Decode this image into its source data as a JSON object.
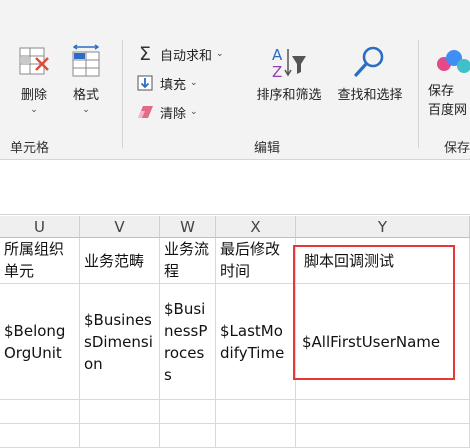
{
  "ribbon": {
    "cells_group": {
      "label": "单元格",
      "delete_label": "删除",
      "format_label": "格式"
    },
    "editing_group": {
      "label": "编辑",
      "autosum_label": "自动求和",
      "fill_label": "填充",
      "clear_label": "清除",
      "sort_filter_label": "排序和筛选",
      "find_select_label": "查找和选择"
    },
    "save_group": {
      "label": "保存",
      "save_to_label_line1": "保存",
      "save_to_label_line2": "百度网"
    }
  },
  "sheet": {
    "columns": [
      "U",
      "V",
      "W",
      "X",
      "Y"
    ],
    "header_row": [
      "所属组织单元",
      "业务范畴",
      "业务流程",
      "最后修改时间",
      "脚本回调测试"
    ],
    "data_row": [
      "$BelongOrgUnit",
      "$BusinessDimension",
      "$BusinessProcess",
      "$LastModifyTime",
      "$AllFirstUserName"
    ]
  },
  "colors": {
    "highlight_border": "#e53935",
    "ribbon_bg": "#f3f3f3",
    "header_bg": "#efefef"
  }
}
